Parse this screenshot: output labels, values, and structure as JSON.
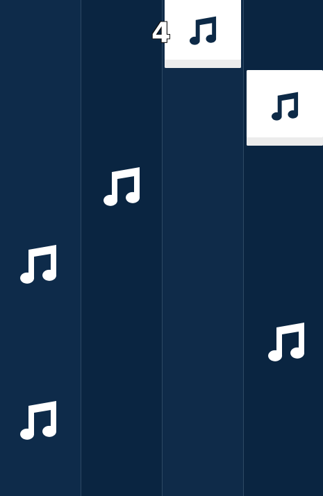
{
  "game": {
    "score": "4",
    "lane_count": 4,
    "icons": {
      "note": "music-note-icon"
    },
    "colors": {
      "lane_dark": "#0a2541",
      "lane_light": "#0e2b4a",
      "divider": "#2d4964",
      "tile": "#ffffff",
      "tile_note": "#0d2a47",
      "floating_note": "#ffffff"
    }
  }
}
